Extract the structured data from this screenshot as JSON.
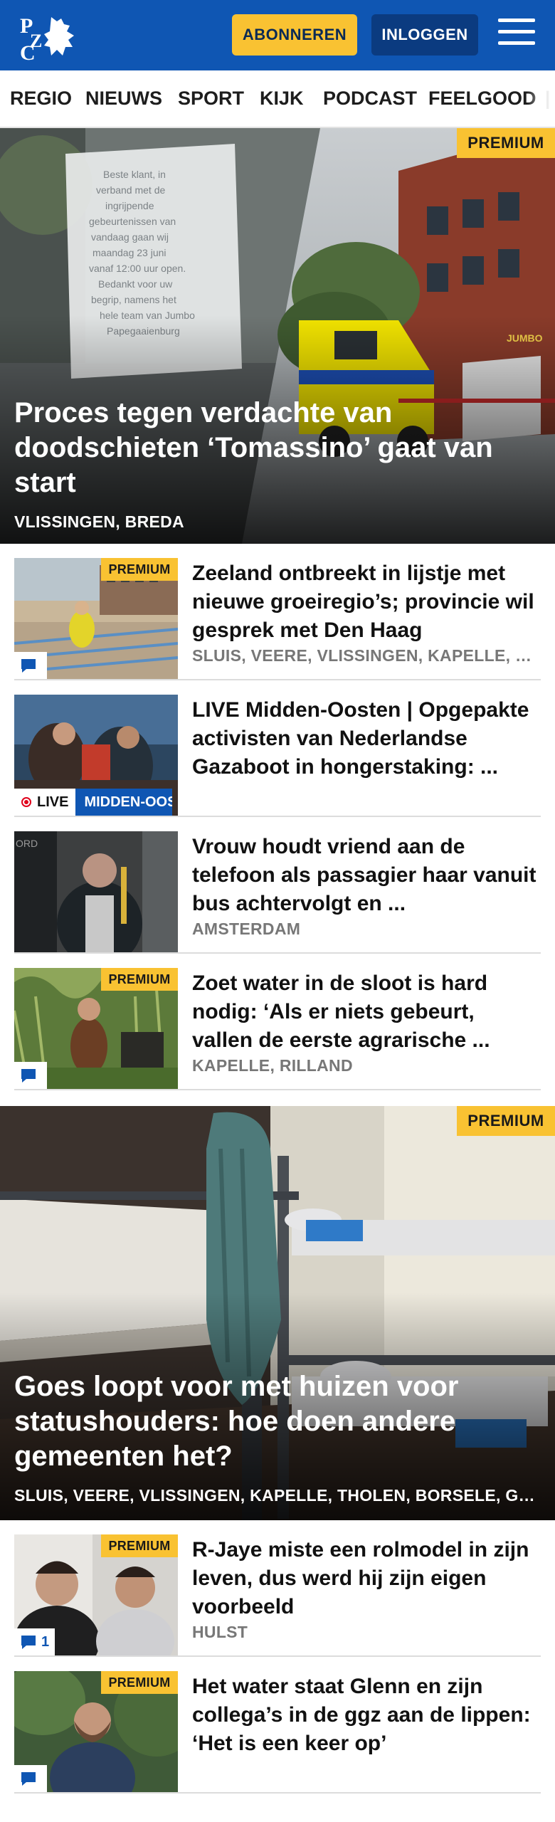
{
  "header": {
    "logo_text": "PZC",
    "subscribe_label": "ABONNEREN",
    "login_label": "INLOGGEN",
    "menu_icon": "hamburger-menu-icon",
    "brand_color": "#0f56b3",
    "accent_color": "#f9c232"
  },
  "nav": {
    "items": [
      "REGIO",
      "NIEUWS",
      "SPORT",
      "KIJK",
      "PODCAST",
      "FEELGOOD"
    ]
  },
  "hero1": {
    "premium": "PREMIUM",
    "title": "Proces tegen verdachte van doodschieten ‘Tomassino’ gaat van start",
    "location": "VLISSINGEN, BREDA",
    "sign_text": "Beste klant, in verband met de ingrijpende gebeurtenissen van vandaag gaan wij maandag 23 juni vanaf 12:00 uur open. Bedankt voor uw begrip, namens het hele team van Jumbo Papegaaienburg",
    "store_sign": "JUMBO"
  },
  "articles": [
    {
      "premium": "PREMIUM",
      "title": "Zeeland ontbreekt in lijstje met nieuwe groeiregio’s; provincie wil gesprek met Den Haag",
      "location": "SLUIS, VEERE, VLISSINGEN, KAPELLE, THOLEN, BORSELE",
      "comment_icon": "comment-icon",
      "comments": ""
    },
    {
      "title": "LIVE Midden-Oosten | Opgepakte activisten van Nederlandse Gazaboot in hongerstaking: ...",
      "live_label": "LIVE",
      "live_topic": "MIDDEN-OOSTEN"
    },
    {
      "title": "Vrouw houdt vriend aan de telefoon als passagier haar vanuit bus achtervolgt en ...",
      "location": "AMSTERDAM"
    },
    {
      "premium": "PREMIUM",
      "title": "Zoet water in de sloot is hard nodig: ‘Als er niets gebeurt, vallen de eerste agrarische ...",
      "location": "KAPELLE, RILLAND",
      "comment_icon": "comment-icon",
      "comments": ""
    }
  ],
  "hero2": {
    "premium": "PREMIUM",
    "title": "Goes loopt voor met huizen voor statushouders: hoe doen andere gemeenten het?",
    "location": "SLUIS, VEERE, VLISSINGEN, KAPELLE, THOLEN, BORSELE, GOES, HULST"
  },
  "articles2": [
    {
      "premium": "PREMIUM",
      "title": "R-Jaye miste een rolmodel in zijn leven, dus werd hij zijn eigen voorbeeld",
      "location": "HULST",
      "comment_icon": "comment-icon",
      "comments": "1"
    },
    {
      "premium": "PREMIUM",
      "title": "Het water staat Glenn en zijn collega’s in de ggz aan de lippen: ‘Het is een keer op’",
      "comment_icon": "comment-icon",
      "comments": ""
    }
  ]
}
